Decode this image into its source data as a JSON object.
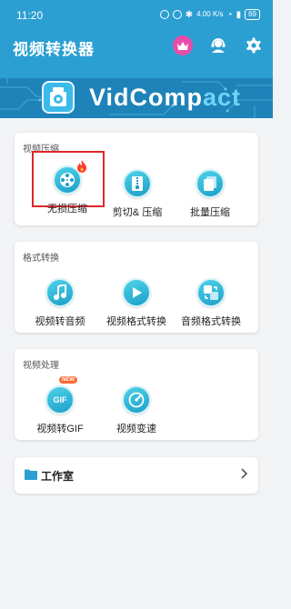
{
  "status_bar": {
    "time": "11:20",
    "net_speed": "4.00 K/s",
    "battery": "69"
  },
  "header": {
    "title": "视频转换器",
    "icons": [
      "crown-icon",
      "customer-service-icon",
      "gear-icon"
    ],
    "accent_color": "#2c9fd2",
    "vip_color": "#e84ea9"
  },
  "banner": {
    "text_part1": "VidComp",
    "text_part2": "act"
  },
  "sections": [
    {
      "title": "视频压缩",
      "items": [
        {
          "label": "无损压缩",
          "icon": "film-reel-icon",
          "highlighted": true,
          "badge": "fire-icon"
        },
        {
          "label": "剪切& 压缩",
          "icon": "zip-file-icon"
        },
        {
          "label": "批量压缩",
          "icon": "batch-files-icon"
        }
      ]
    },
    {
      "title": "格式转换",
      "items": [
        {
          "label": "视频转音频",
          "icon": "music-note-icon"
        },
        {
          "label": "视频格式转换",
          "icon": "play-icon"
        },
        {
          "label": "音频格式转换",
          "icon": "audio-convert-icon"
        }
      ]
    },
    {
      "title": "视频处理",
      "items": [
        {
          "label": "视频转GIF",
          "icon": "gif-icon",
          "badge_text": "NEW",
          "icon_text": "GIF"
        },
        {
          "label": "视频变速",
          "icon": "speedometer-icon"
        }
      ]
    }
  ],
  "workroom": {
    "label": "工作室",
    "icon": "folder-icon"
  }
}
